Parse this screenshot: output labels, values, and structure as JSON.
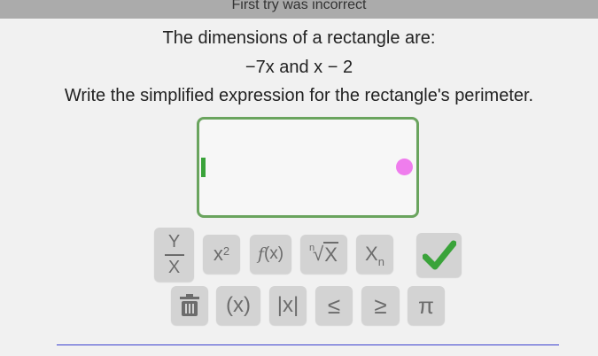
{
  "banner": {
    "text": "First try was incorrect"
  },
  "problem": {
    "line1": "The dimensions of a rectangle are:",
    "line2": "−7x  and  x − 2",
    "line3": "Write the simplified expression for the rectangle's perimeter."
  },
  "answer": {
    "value": ""
  },
  "keypad": {
    "frac_top": "Y",
    "frac_bottom": "X",
    "square_base": "x",
    "square_exp": "2",
    "fx_f": "f",
    "fx_rest": "(x)",
    "root_index": "n",
    "root_arg": "X",
    "sub_base": "X",
    "sub_index": "n",
    "paren": "(x)",
    "abs": "|x|",
    "le": "≤",
    "ge": "≥",
    "pi": "π"
  },
  "icons": {
    "cursor": "text-cursor-icon",
    "dot": "pink-dot-icon",
    "check": "check-icon",
    "delete": "trash-icon"
  },
  "colors": {
    "answer_border": "#6aa45e",
    "check": "#3aa33a",
    "dot": "#ef7ded",
    "divider": "#3b40d0"
  }
}
